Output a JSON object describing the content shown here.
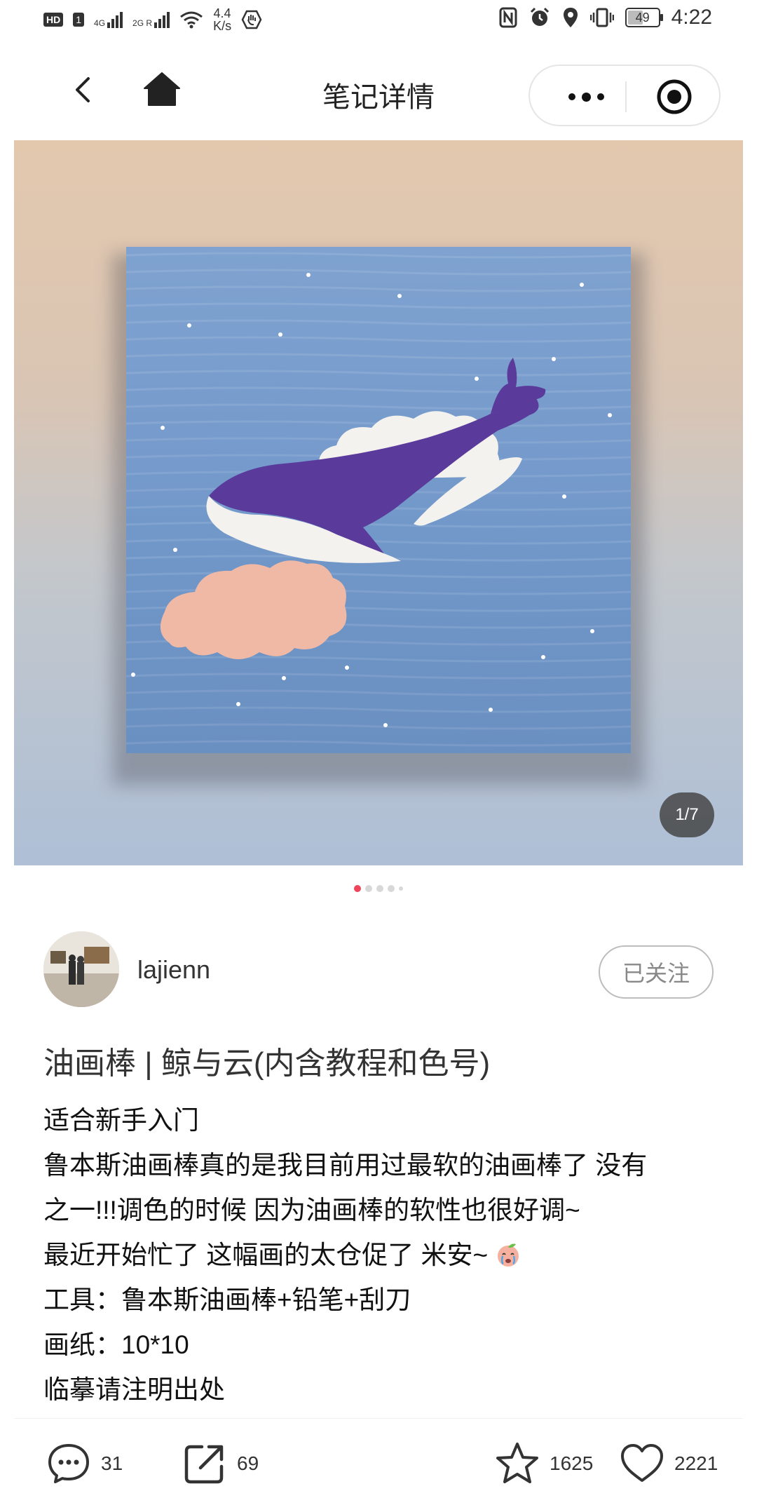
{
  "status_bar": {
    "hd_label": "HD",
    "sim_label": "1",
    "net1": "4G",
    "net2": "2G R",
    "speed_value": "4.4",
    "speed_unit": "K/s",
    "battery": "49",
    "time": "4:22"
  },
  "nav": {
    "title": "笔记详情"
  },
  "hero": {
    "pager": "1/7",
    "total_images": 7,
    "current_index": 1
  },
  "author": {
    "username": "lajienn",
    "follow_label": "已关注"
  },
  "post": {
    "title": "油画棒 | 鲸与云(内含教程和色号)",
    "lines": [
      "适合新手入门",
      "鲁本斯油画棒真的是我目前用过最软的油画棒了 没有",
      "之一!!!调色的时候 因为油画棒的软性也很好调~",
      "最近开始忙了 这幅画的太仓促了 米安~",
      "工具：鲁本斯油画棒+铅笔+刮刀",
      "画纸：10*10",
      "临摹请注明出处"
    ]
  },
  "actions": {
    "comments": "31",
    "shares": "69",
    "favorites": "1625",
    "likes": "2221"
  },
  "colors": {
    "accent": "#f0445a",
    "canvas_blue": "#7197c9",
    "whale_purple": "#5a3a9a",
    "cloud_pink": "#f0b9a5"
  }
}
